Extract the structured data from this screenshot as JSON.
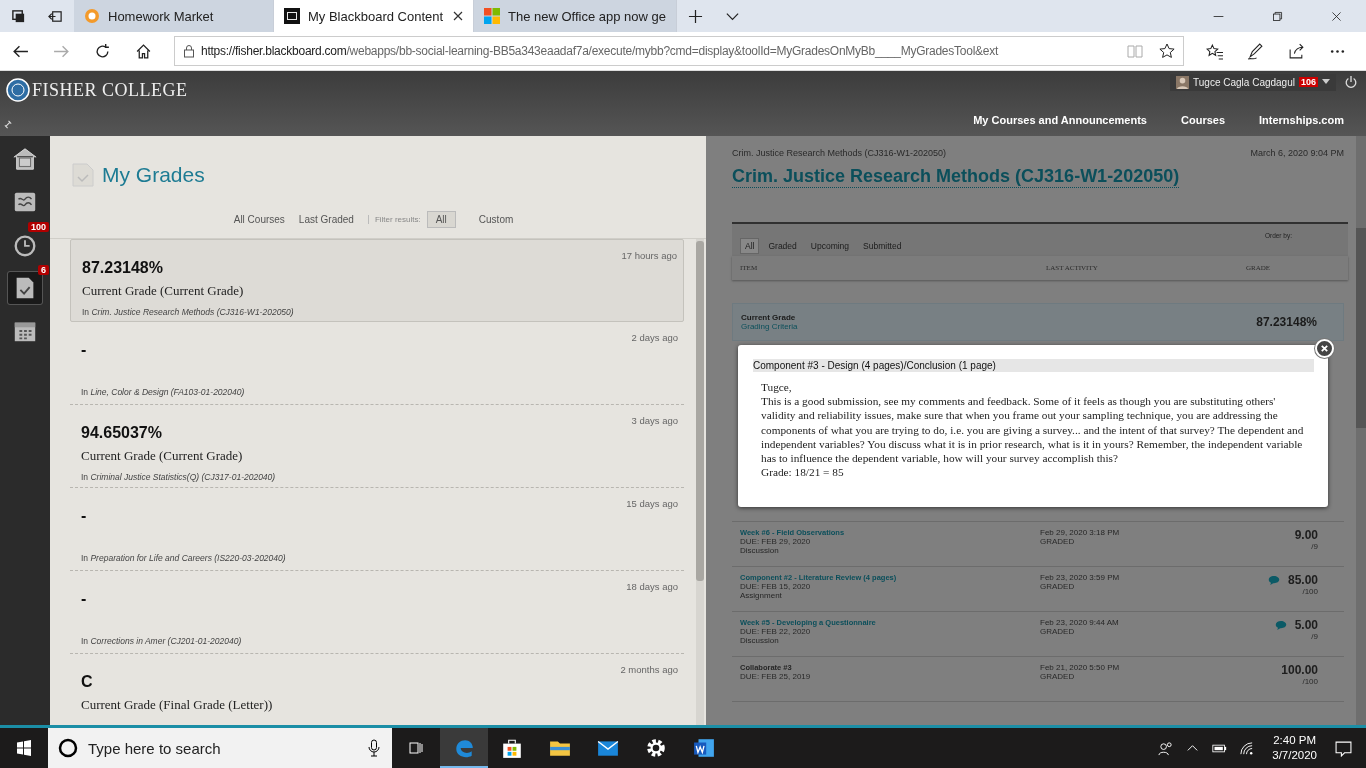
{
  "browser": {
    "tabs": [
      {
        "label": "Homework Market",
        "selected": false
      },
      {
        "label": "My Blackboard Content",
        "selected": true
      },
      {
        "label": "The new Office app now ge",
        "selected": false
      }
    ],
    "url_host": "https://fisher.blackboard.com",
    "url_path": "/webapps/bb-social-learning-BB5a343eaadaf7a/execute/mybb?cmd=display&toolId=MyGradesOnMyBb____MyGradesTool&ext"
  },
  "header": {
    "logo": "FISHER COLLEGE",
    "user": "Tugce Cagla Cagdagul",
    "user_badge": "106",
    "nav": [
      "My Courses and Announcements",
      "Courses",
      "Internships.com"
    ]
  },
  "rail": [
    {
      "selected": false
    },
    {
      "selected": false
    },
    {
      "badge": "100",
      "selected": false
    },
    {
      "badge": "6",
      "selected": true
    },
    {
      "selected": false
    }
  ],
  "grades": {
    "title": "My Grades",
    "filters": [
      {
        "label": "All Courses",
        "kind": "link"
      },
      {
        "label": "Last Graded",
        "kind": "link"
      },
      {
        "label": "Filter results:",
        "kind": "label"
      },
      {
        "label": "All",
        "kind": "pill",
        "selected": true
      },
      {
        "label": "Custom",
        "kind": "pill",
        "selected": false
      }
    ],
    "items": [
      {
        "grade": "87.23148%",
        "title": "Current Grade (Current Grade)",
        "course": "In *Crim. Justice Research Methods (CJ316-W1-202050)*",
        "time": "17 hours ago",
        "selected": true
      },
      {
        "grade": "-",
        "course": "In *Line, Color & Design (FA103-01-202040)*",
        "time": "2 days ago",
        "selected": false
      },
      {
        "grade": "94.65037%",
        "title": "Current Grade (Current Grade)",
        "course": "In *Criminal Justice Statistics(Q) (CJ317-01-202040)*",
        "time": "3 days ago",
        "selected": false
      },
      {
        "grade": "-",
        "course": "In *Preparation for Life and Careers (IS220-03-202040)*",
        "time": "15 days ago",
        "selected": false
      },
      {
        "grade": "-",
        "course": "In *Corrections in Amer (CJ201-01-202040)*",
        "time": "18 days ago",
        "selected": false
      },
      {
        "grade": "C",
        "title": "Current Grade (Final Grade (Letter))",
        "time": "2 months ago",
        "selected": false
      }
    ]
  },
  "detail": {
    "breadcrumb": "Crim. Justice Research Methods (CJ316-W1-202050)",
    "date": "March 6, 2020 9:04 PM",
    "title": "Crim. Justice Research Methods (CJ316-W1-202050)",
    "filters": [
      {
        "label": "All",
        "selected": true
      },
      {
        "label": "Graded",
        "selected": false
      },
      {
        "label": "Upcoming",
        "selected": false
      },
      {
        "label": "Submitted",
        "selected": false
      }
    ],
    "order_by": "Order by:",
    "columns": [
      "ITEM",
      "LAST ACTIVITY",
      "GRADE"
    ],
    "current": {
      "label": "Current Grade",
      "link": "Grading Criteria",
      "value": "87.23148%"
    },
    "rows": [
      {
        "title": "Week #6 - Field Observations",
        "due": "DUE: FEB 29, 2020",
        "type": "Discussion",
        "activity": "Feb 29, 2020 3:18 PM",
        "status": "GRADED",
        "grade": "9.00",
        "out_of": "/9",
        "feedback": false,
        "link": true
      },
      {
        "title": "Component #2 - Literature Review (4 pages)",
        "due": "DUE: FEB 15, 2020",
        "type": "Assignment",
        "activity": "Feb 23, 2020 3:59 PM",
        "status": "GRADED",
        "grade": "85.00",
        "out_of": "/100",
        "feedback": true,
        "link": true
      },
      {
        "title": "Week #5 - Developing a Questionnaire",
        "due": "DUE: FEB 22, 2020",
        "type": "Discussion",
        "activity": "Feb 23, 2020 9:44 AM",
        "status": "GRADED",
        "grade": "5.00",
        "out_of": "/9",
        "feedback": true,
        "link": true
      },
      {
        "title": "Collaborate #3",
        "due": "DUE: FEB 25, 2019",
        "activity": "Feb 21, 2020 5:50 PM",
        "status": "GRADED",
        "grade": "100.00",
        "out_of": "/100",
        "feedback": false,
        "link": false
      }
    ]
  },
  "modal": {
    "title": "Component #3 - Design (4 pages)/Conclusion (1 page)",
    "greeting": "Tugce,",
    "body": "This is a good submission, see my comments and feedback. Some of it feels as though you are substituting others' validity and reliability issues, make sure that when you frame out your sampling technique, you are addressing the components of what you are trying to do, i.e. you are giving a survey... and the intent of that survey? The dependent and independent variables? You discuss what it is in prior research, what is it in yours? Remember, the independent variable has to influence the dependent variable, how will your survey accomplish this?",
    "grade_line": "Grade: 18/21 = 85"
  },
  "taskbar": {
    "search_placeholder": "Type here to search",
    "time": "2:40 PM",
    "date": "3/7/2020"
  }
}
